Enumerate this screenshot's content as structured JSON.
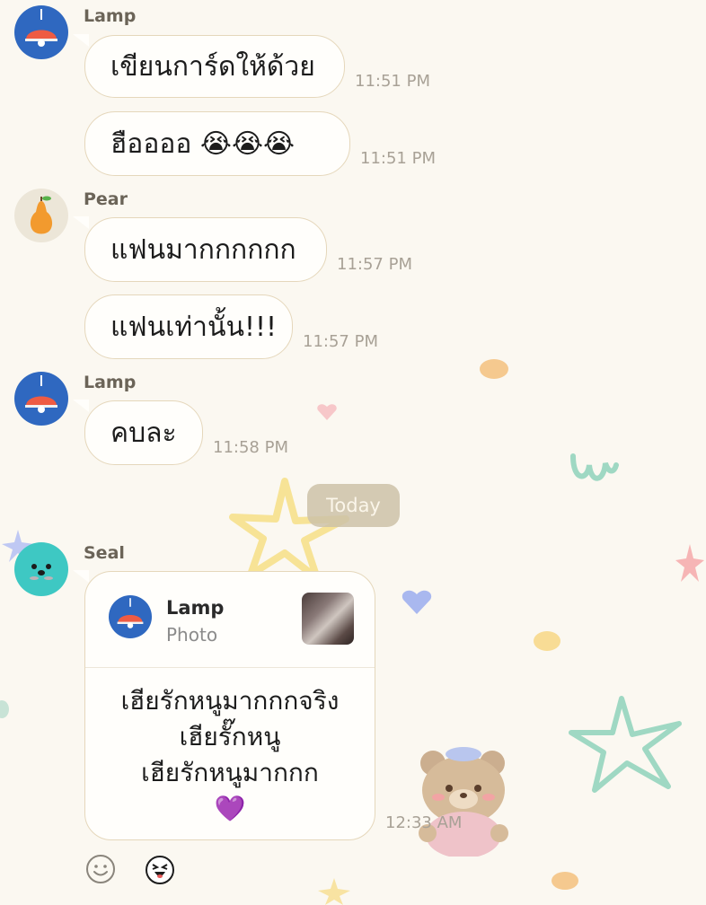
{
  "chat": {
    "messages": [
      {
        "sender": "Lamp",
        "text": "เขียนการ์ดให้ด้วย",
        "time": "11:51 PM"
      },
      {
        "sender": "",
        "text": "ฮืออออ 😭😭😭",
        "time": "11:51 PM"
      },
      {
        "sender": "Pear",
        "text": "แฟนมากกกกกก",
        "time": "11:57 PM"
      },
      {
        "sender": "",
        "text": "แฟนเท่านั้น!!!",
        "time": "11:57 PM"
      },
      {
        "sender": "Lamp",
        "text": "คบละ",
        "time": "11:58 PM"
      }
    ],
    "day_separator": "Today",
    "reply": {
      "sender": "Seal",
      "quoted_name": "Lamp",
      "quoted_type": "Photo",
      "lines": [
        "เฮียรักหนูมากกกจริง",
        "เฮียรั๊กหนู",
        "เฮียรักหนูมากกก",
        "💜"
      ],
      "time": "12:33 AM"
    }
  },
  "icons": {
    "lamp_avatar": "lamp-icon",
    "pear_avatar": "pear-icon",
    "seal_avatar": "seal-icon",
    "emoji_button": "smiley-icon",
    "sticker_button": "sticker-face-icon"
  },
  "colors": {
    "background": "#fbf8f1",
    "bubble": "#fffefb",
    "bubble_border": "#e5d7bb",
    "lamp_avatar": "#2f68c0",
    "seal_avatar": "#3ec8c3"
  }
}
